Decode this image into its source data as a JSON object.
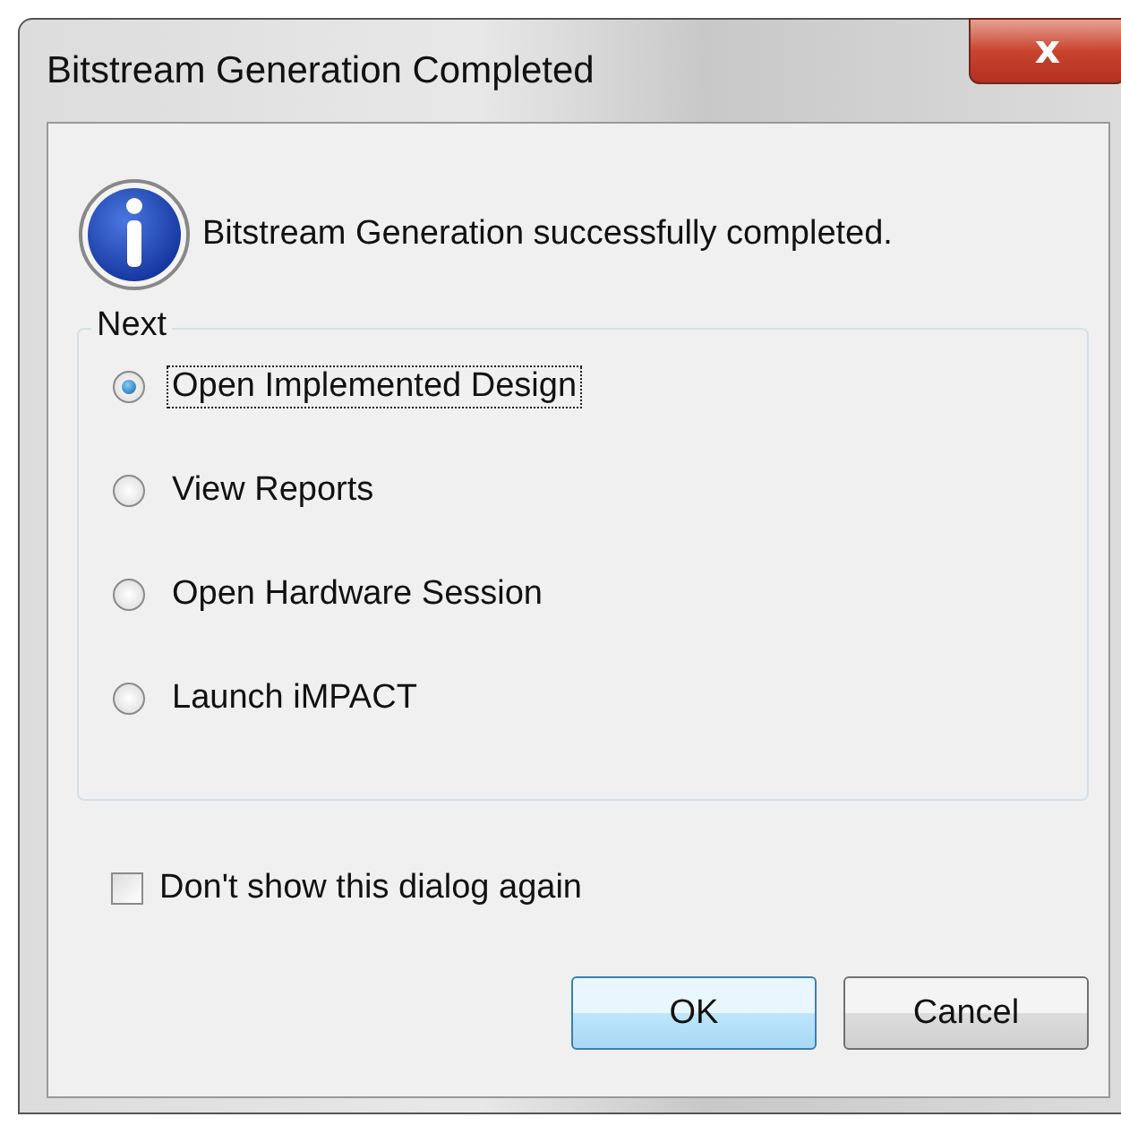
{
  "window": {
    "title": "Bitstream Generation Completed",
    "close": "x"
  },
  "message": "Bitstream Generation successfully completed.",
  "group": {
    "title": "Next",
    "options": [
      {
        "label": "Open Implemented Design",
        "selected": true,
        "focused": true
      },
      {
        "label": "View Reports",
        "selected": false,
        "focused": false
      },
      {
        "label": "Open Hardware Session",
        "selected": false,
        "focused": false
      },
      {
        "label": "Launch iMPACT",
        "selected": false,
        "focused": false
      }
    ]
  },
  "checkbox": {
    "label": "Don't show this dialog again",
    "checked": false
  },
  "buttons": [
    {
      "label": "OK",
      "kind": "default"
    },
    {
      "label": "Cancel",
      "kind": "normal"
    }
  ]
}
